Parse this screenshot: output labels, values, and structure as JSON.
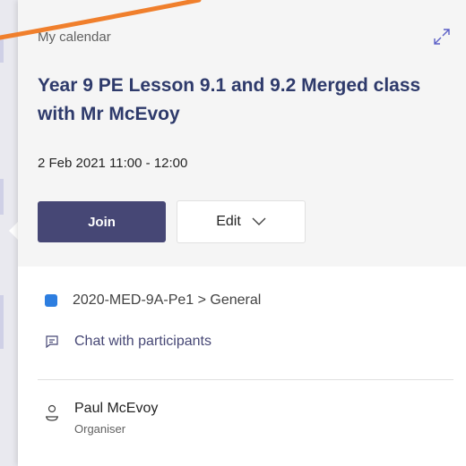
{
  "header": {
    "calendar_label": "My calendar",
    "expand_icon": "expand-icon"
  },
  "event": {
    "title": "Year 9 PE Lesson 9.1 and 9.2 Merged class with Mr McEvoy",
    "datetime": "2 Feb 2021 11:00 - 12:00"
  },
  "actions": {
    "join_label": "Join",
    "edit_label": "Edit"
  },
  "details": {
    "channel": "2020-MED-9A-Pe1 > General",
    "chat_label": "Chat with participants",
    "organiser_name": "Paul McEvoy",
    "organiser_role": "Organiser"
  },
  "colors": {
    "accent": "#464775",
    "title": "#2e3a6b",
    "annotation": "#f07f2c",
    "teams_icon": "#2d7ee0"
  }
}
